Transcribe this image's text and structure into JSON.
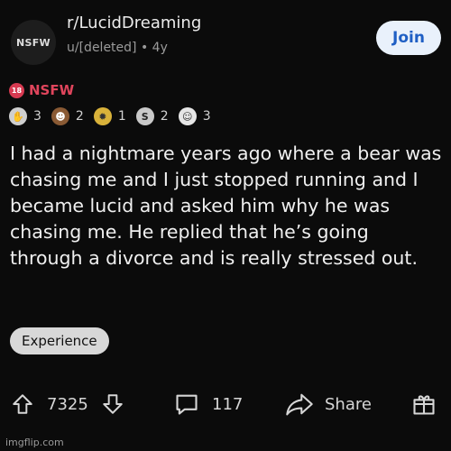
{
  "subreddit": {
    "avatar_text": "NSFW",
    "name": "r/LucidDreaming",
    "meta": "u/[deleted] • 4y",
    "join_label": "Join"
  },
  "nsfw": {
    "badge_number": "18",
    "label": "NSFW"
  },
  "awards": [
    {
      "icon": "hand-award-icon",
      "count": "3"
    },
    {
      "icon": "face-award-icon",
      "count": "2"
    },
    {
      "icon": "lightbulb-award-icon",
      "count": "1"
    },
    {
      "icon": "silver-coin-award-icon",
      "count": "2"
    },
    {
      "icon": "wholesome-award-icon",
      "count": "3"
    }
  ],
  "post": {
    "body": "I had a nightmare years ago where a bear was chasing me and I just stopped running and I became lucid and asked him why he was chasing me. He replied that he’s going through a divorce and is really stressed out.",
    "flair": "Experience"
  },
  "actions": {
    "upvotes": "7325",
    "comments": "117",
    "share_label": "Share"
  },
  "watermark": "imgflip.com",
  "colors": {
    "background": "#0b0b0b",
    "join_bg": "#e9f1fb",
    "join_text": "#1f5fc4",
    "nsfw_red": "#e0455c",
    "flair_bg": "#d8d8d8"
  }
}
